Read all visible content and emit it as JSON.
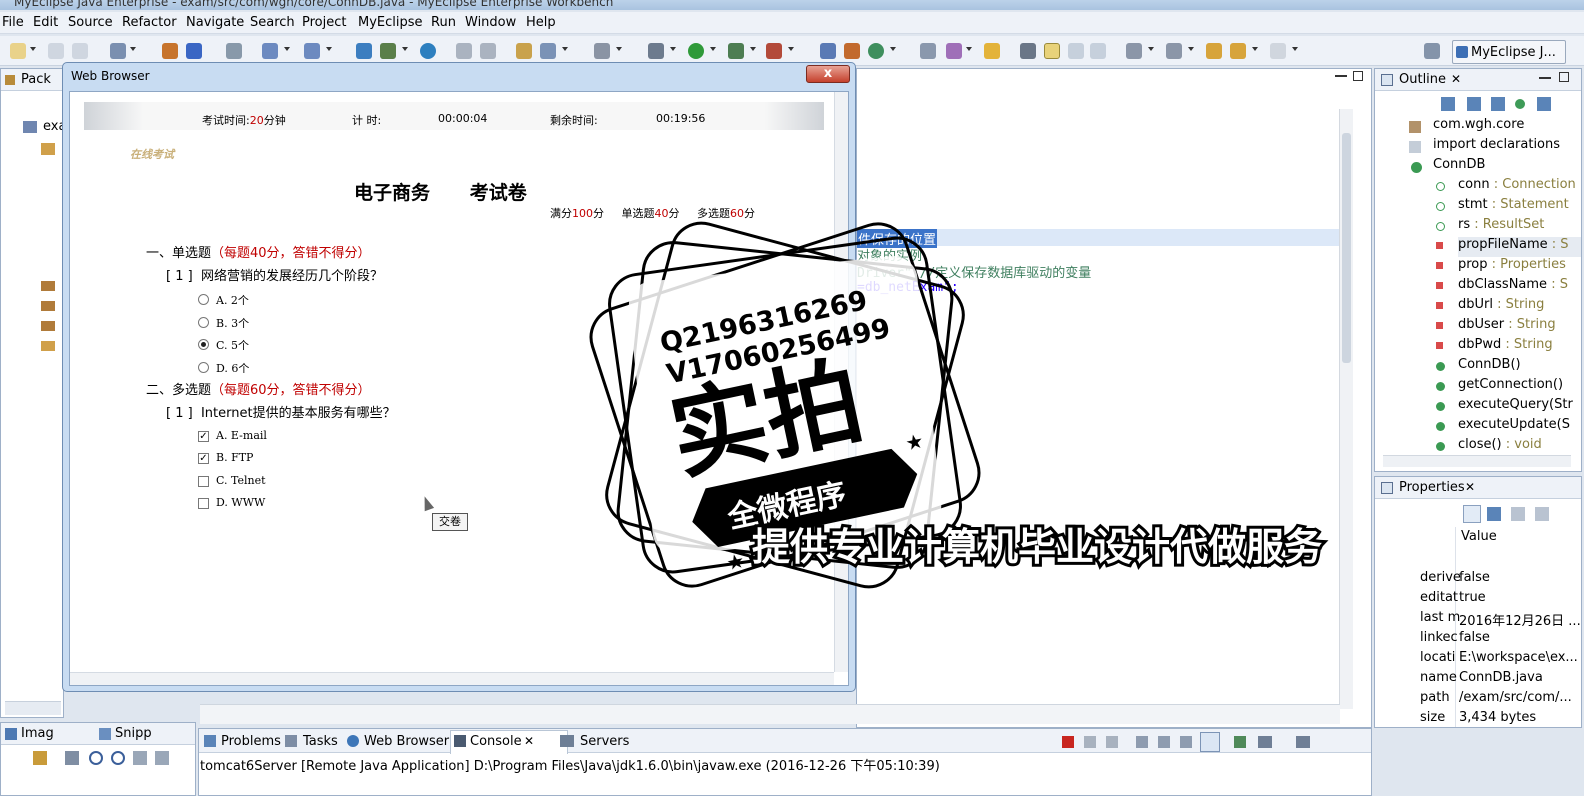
{
  "window": {
    "title": "MyEclipse Java Enterprise - exam/src/com/wgh/core/ConnDB.java - MyEclipse Enterprise Workbench"
  },
  "menu": [
    "File",
    "Edit",
    "Source",
    "Refactor",
    "Navigate",
    "Search",
    "Project",
    "MyEclipse",
    "Run",
    "Window",
    "Help"
  ],
  "perspective": {
    "label": "MyEclipse J..."
  },
  "package_explorer": {
    "tab": "Pack",
    "item": "exa"
  },
  "outline": {
    "tab": "Outline",
    "items": [
      {
        "name": "com.wgh.core",
        "type": ""
      },
      {
        "name": "import declarations",
        "type": ""
      },
      {
        "name": "ConnDB",
        "type": ""
      },
      {
        "name": "conn",
        "type": " : Connection"
      },
      {
        "name": "stmt",
        "type": " : Statement"
      },
      {
        "name": "rs",
        "type": " : ResultSet"
      },
      {
        "name": "propFileName",
        "type": " : S"
      },
      {
        "name": "prop",
        "type": " : Properties"
      },
      {
        "name": "dbClassName",
        "type": " : S"
      },
      {
        "name": "dbUrl",
        "type": " : String"
      },
      {
        "name": "dbUser",
        "type": " : String"
      },
      {
        "name": "dbPwd",
        "type": " : String"
      },
      {
        "name": "ConnDB()",
        "type": ""
      },
      {
        "name": "getConnection()",
        "type": ""
      },
      {
        "name": "executeQuery(Str",
        "type": ""
      },
      {
        "name": "executeUpdate(S",
        "type": ""
      },
      {
        "name": "close()",
        "type": " : void"
      }
    ]
  },
  "properties": {
    "tab": "Properties",
    "value_header": "Value",
    "rows": [
      {
        "key": "derive",
        "value": "false"
      },
      {
        "key": "editat",
        "value": "true"
      },
      {
        "key": "last m",
        "value": "2016年12月26日 ..."
      },
      {
        "key": "linkec",
        "value": "false"
      },
      {
        "key": "locati",
        "value": "E:\\workspace\\ex..."
      },
      {
        "key": "name",
        "value": "ConnDB.java"
      },
      {
        "key": "path",
        "value": "/exam/src/com/..."
      },
      {
        "key": "size",
        "value": "3,434  bytes"
      }
    ]
  },
  "editor": {
    "lines": [
      "件保存的位置",
      "对象的实例",
      "Driver\";//定义保存数据库驱动的变量",
      "=db_netExam\";"
    ]
  },
  "browser": {
    "title": "Web Browser",
    "close": "x",
    "timer": {
      "exam_time_label": "考试时间:",
      "exam_time_value": "20",
      "exam_time_unit": "分钟",
      "elapsed_label": "计 时:",
      "elapsed_value": "00:00:04",
      "remaining_label": "剩余时间:",
      "remaining_value": "00:19:56"
    },
    "logo_text": "在线考试",
    "paper_title": "电子商务      考试卷",
    "score": {
      "total_label": "满分",
      "total": "100",
      "total_unit": "分",
      "single_label": "单选题",
      "single": "40",
      "single_unit": "分",
      "multi_label": "多选题",
      "multi": "60",
      "multi_unit": "分"
    },
    "section1": {
      "title": "一、单选题",
      "note": "（每题40分，答错不得分）"
    },
    "q1": {
      "num": "[ 1 ]",
      "text": "网络营销的发展经历几个阶段？",
      "options": [
        "A. 2个",
        "B. 3个",
        "C. 5个",
        "D. 6个"
      ],
      "selected": 2
    },
    "section2": {
      "title": "二、多选题",
      "note": "（每题60分，答错不得分）"
    },
    "q2": {
      "num": "[ 1 ]",
      "text": "Internet提供的基本服务有哪些？",
      "options": [
        "A. E-mail",
        "B. FTP",
        "C. Telnet",
        "D. WWW"
      ],
      "checked": [
        true,
        true,
        false,
        false
      ]
    },
    "submit": "交卷"
  },
  "bottom_left_tabs": [
    "Imag",
    "Snipp"
  ],
  "bottom_tabs": [
    "Problems",
    "Tasks",
    "Web Browser",
    "Console",
    "Servers"
  ],
  "console": {
    "text": "tomcat6Server [Remote Java Application] D:\\Program Files\\Java\\jdk1.6.0\\bin\\javaw.exe (2016-12-26 下午05:10:39)"
  },
  "watermark": {
    "qq": "Q2196316269",
    "wechat": "V17060256499",
    "big": "实拍",
    "ribbon": "全微程序",
    "service": "提供专业计算机毕业设计代做服务"
  }
}
